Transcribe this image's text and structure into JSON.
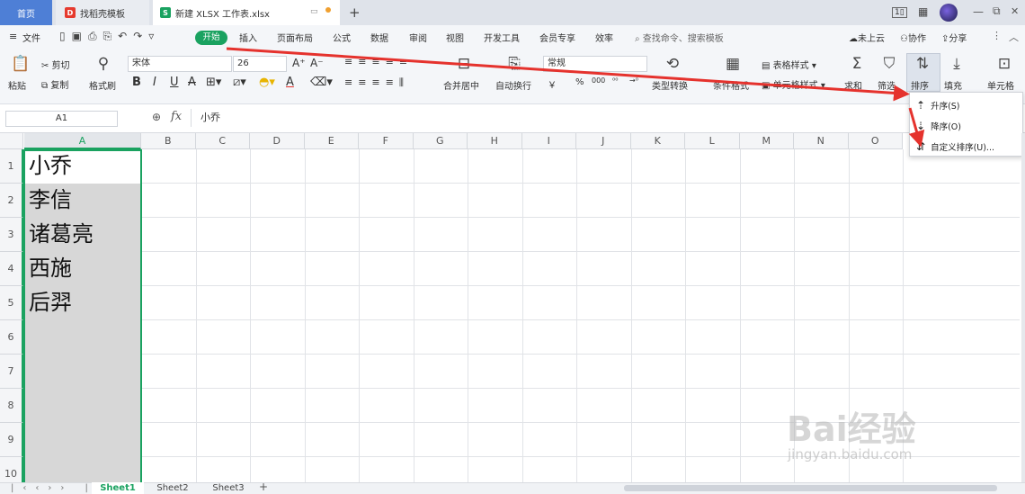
{
  "tabs": {
    "home": "首页",
    "daoke": "找稻壳模板",
    "file": "新建 XLSX 工作表.xlsx",
    "add": "+"
  },
  "window": {
    "min": "—",
    "restore": "⧉",
    "close": "✕"
  },
  "menubar": {
    "file": "文件",
    "items": [
      "开始",
      "插入",
      "页面布局",
      "公式",
      "数据",
      "审阅",
      "视图",
      "开发工具",
      "会员专享",
      "效率"
    ],
    "search_placeholder": "查找命令、搜索模板",
    "cloud": "未上云",
    "collab": "协作",
    "share": "分享"
  },
  "ribbon": {
    "paste": "粘贴",
    "cut": "剪切",
    "copy": "复制",
    "format_painter": "格式刷",
    "font_name": "宋体",
    "font_size": "26",
    "bold": "B",
    "italic": "I",
    "underline": "U",
    "strike": "A",
    "font_color": "A",
    "merge_center": "合并居中",
    "wrap": "自动换行",
    "number_format": "常规",
    "currency": "￥",
    "percent": "%",
    "thousands": "000",
    "type_convert": "类型转换",
    "cond_format": "条件格式",
    "table_style": "表格样式",
    "cell_style": "单元格样式",
    "sum": "求和",
    "filter": "筛选",
    "sort": "排序",
    "fill": "填充",
    "cell": "单元格"
  },
  "formula_bar": {
    "name_box": "A1",
    "fx": "fx",
    "content": "小乔"
  },
  "sheet": {
    "columns": [
      "A",
      "B",
      "C",
      "D",
      "E",
      "F",
      "G",
      "H",
      "I",
      "J",
      "K",
      "L",
      "M",
      "N",
      "O"
    ],
    "rows": [
      "1",
      "2",
      "3",
      "4",
      "5",
      "6",
      "7",
      "8",
      "9",
      "10"
    ],
    "cells_A": [
      "小乔",
      "李信",
      "诸葛亮",
      "西施",
      "后羿"
    ]
  },
  "sort_menu": {
    "asc": "升序(S)",
    "desc": "降序(O)",
    "custom": "自定义排序(U)..."
  },
  "sheet_tabs": [
    "Sheet1",
    "Sheet2",
    "Sheet3"
  ],
  "watermark": {
    "brand": "Bai经验",
    "url": "jingyan.baidu.com"
  },
  "colors": {
    "accent_green": "#1aa260",
    "tab_blue": "#4e7fd6",
    "arrow_red": "#e5322d",
    "selection": "#d6d6d6"
  }
}
